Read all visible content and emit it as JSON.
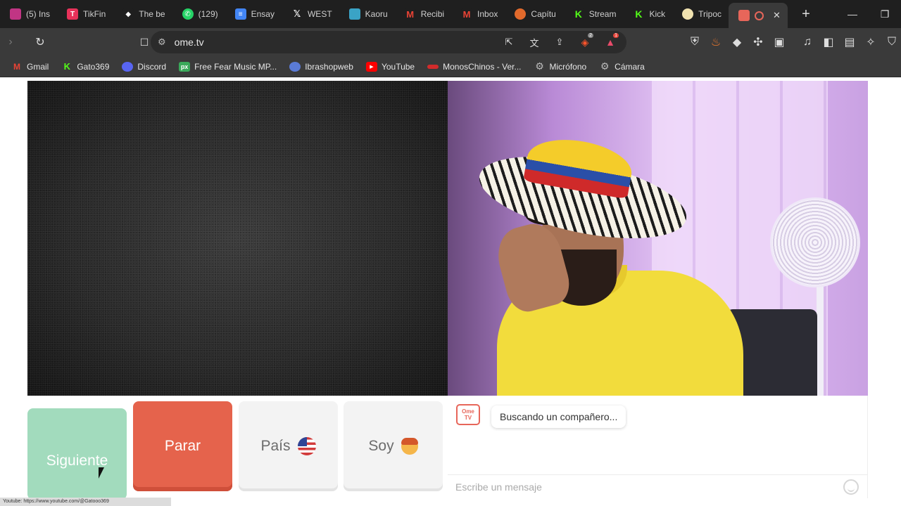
{
  "tabs": [
    {
      "label": "(5) Ins",
      "icon": "instagram-icon",
      "color": "#c13584"
    },
    {
      "label": "TikFin",
      "icon": "tikfinity-icon",
      "color": "#e8325a"
    },
    {
      "label": "The be",
      "icon": "diamond-icon",
      "color": "#ffffff"
    },
    {
      "label": "(129)",
      "icon": "whatsapp-icon",
      "color": "#25d366"
    },
    {
      "label": "Ensay",
      "icon": "docs-icon",
      "color": "#4285f4"
    },
    {
      "label": "WEST",
      "icon": "x-icon",
      "color": "#000000"
    },
    {
      "label": "Kaoru",
      "icon": "kaoru-icon",
      "color": "#3aa3c6"
    },
    {
      "label": "Recibi",
      "icon": "gmail-icon",
      "color": "#ea4335"
    },
    {
      "label": "Inbox",
      "icon": "gmail-icon",
      "color": "#ea4335"
    },
    {
      "label": "Capítu",
      "icon": "manga-icon",
      "color": "#e26a2c"
    },
    {
      "label": "Stream",
      "icon": "kick-icon",
      "color": "#53fc18"
    },
    {
      "label": "Kick",
      "icon": "kick-icon",
      "color": "#53fc18"
    },
    {
      "label": "Tripoc",
      "icon": "tripod-icon",
      "color": "#f0e2b0"
    }
  ],
  "active_tab": {
    "icon": "ome-tv-icon",
    "recording": "recording-icon"
  },
  "toolbar": {
    "url": "ome.tv",
    "extension_badges": [
      "2",
      "1"
    ]
  },
  "bookmarks": [
    {
      "label": "Gmail",
      "color": "#ea4335",
      "icon": "gmail-icon"
    },
    {
      "label": "Gato369",
      "color": "#53fc18",
      "icon": "kick-icon"
    },
    {
      "label": "Discord",
      "color": "#5865f2",
      "icon": "discord-icon"
    },
    {
      "label": "Free Fear Music MP...",
      "color": "#3aa95a",
      "icon": "px-icon"
    },
    {
      "label": "Ibrashopweb",
      "color": "#5a7bd6",
      "icon": "ibrashop-icon"
    },
    {
      "label": "YouTube",
      "color": "#ff0000",
      "icon": "youtube-icon"
    },
    {
      "label": "MonosChinos - Ver...",
      "color": "#d22b2b",
      "icon": "monoschinos-icon"
    },
    {
      "label": "Micrófono",
      "color": "#9e9e9e",
      "icon": "gear-icon"
    },
    {
      "label": "Cámara",
      "color": "#9e9e9e",
      "icon": "gear-icon"
    }
  ],
  "controls": {
    "next_label": "Siguiente",
    "stop_label": "Parar",
    "country_label": "País",
    "gender_label": "Soy"
  },
  "chat": {
    "logo_line1": "Ome",
    "logo_line2": "TV",
    "status_message": "Buscando un compañero...",
    "input_placeholder": "Escribe un mensaje"
  },
  "statusbar": {
    "text": "Youtube: https://www.youtube.com/@Gatooo369"
  },
  "colors": {
    "next": "#a2dbbd",
    "stop": "#e5634c",
    "neutral": "#f3f3f3"
  }
}
